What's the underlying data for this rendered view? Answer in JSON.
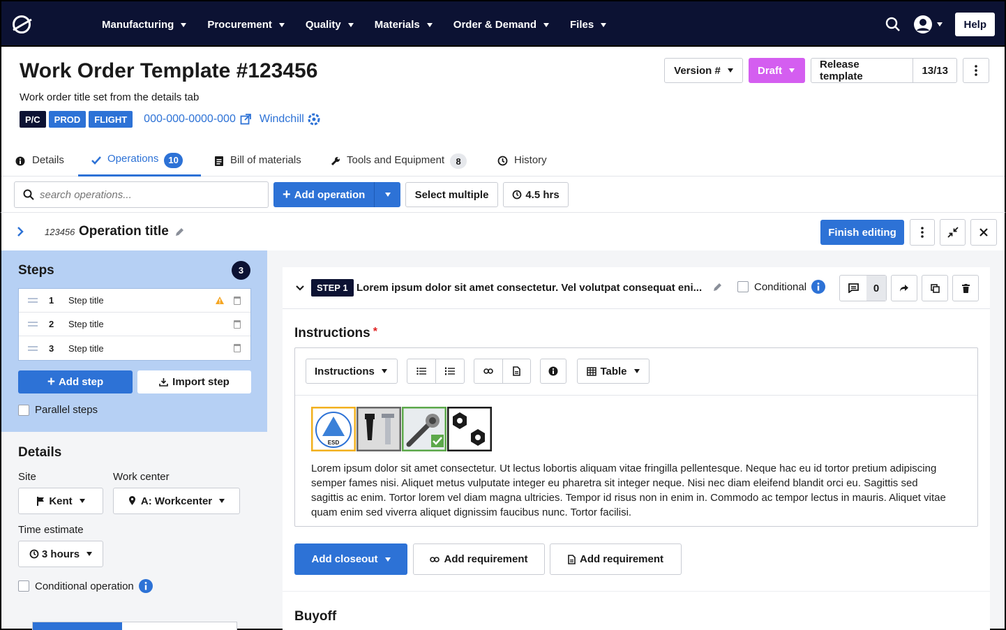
{
  "nav": {
    "items": [
      "Manufacturing",
      "Procurement",
      "Quality",
      "Materials",
      "Order & Demand",
      "Files"
    ],
    "help": "Help"
  },
  "header": {
    "title": "Work Order Template #123456",
    "subtitle": "Work order title set from the details tab",
    "tags": [
      {
        "label": "P/C",
        "color": "#0c1233"
      },
      {
        "label": "PROD",
        "color": "#2d72d6"
      },
      {
        "label": "FLIGHT",
        "color": "#2d72d6"
      }
    ],
    "part_link": "000-000-0000-000",
    "windchill": "Windchill",
    "version": "Version #",
    "status": "Draft",
    "status_color": "#d45ef0",
    "release": "Release template",
    "release_count": "13/13"
  },
  "tabs": [
    {
      "label": "Details",
      "count": ""
    },
    {
      "label": "Operations",
      "count": "10"
    },
    {
      "label": "Bill of materials",
      "count": ""
    },
    {
      "label": "Tools and Equipment",
      "count": "8"
    },
    {
      "label": "History",
      "count": ""
    }
  ],
  "toolbar": {
    "search_placeholder": "search operations...",
    "add_operation": "Add operation",
    "select_multiple": "Select multiple",
    "duration": "4.5 hrs"
  },
  "operation": {
    "number": "123456",
    "title": "Operation title",
    "finish": "Finish editing"
  },
  "steps": {
    "heading": "Steps",
    "count": "3",
    "items": [
      {
        "num": "1",
        "title": "Step title",
        "warning": true
      },
      {
        "num": "2",
        "title": "Step title",
        "warning": false
      },
      {
        "num": "3",
        "title": "Step title",
        "warning": false
      }
    ],
    "add_step": "Add step",
    "import_step": "Import step",
    "parallel": "Parallel steps"
  },
  "details": {
    "heading": "Details",
    "site_label": "Site",
    "site_value": "Kent",
    "workcenter_label": "Work center",
    "workcenter_value": "A: Workcenter",
    "time_label": "Time estimate",
    "time_value": "3 hours",
    "conditional": "Conditional operation"
  },
  "step_card": {
    "badge": "STEP 1",
    "title": "Lorem ipsum dolor sit amet consectetur. Vel volutpat consequat eni...",
    "conditional": "Conditional",
    "comment_count": "0",
    "instructions_heading": "Instructions",
    "required_mark": "*",
    "editor_style": "Instructions",
    "table": "Table",
    "esd_label": "ESD",
    "body": "Lorem ipsum dolor sit amet consectetur. Ut lectus lobortis aliquam vitae fringilla pellentesque. Neque hac eu id tortor pretium adipiscing semper fames nisi. Aliquet metus vulputate integer eu pharetra sit integer neque. Nisi nec diam eleifend blandit orci eu. Sagittis sed sagittis ac enim. Tortor lorem vel diam magna ultricies. Tempor id risus non in enim in. Commodo ac tempor lectus in mauris. Aliquet vitae quam enim sed viverra aliquet dignissim faucibus nunc. Tortor facilisi.",
    "add_closeout": "Add closeout",
    "add_requirement_1": "Add requirement",
    "add_requirement_2": "Add requirement",
    "buyoff_heading": "Buyoff"
  }
}
